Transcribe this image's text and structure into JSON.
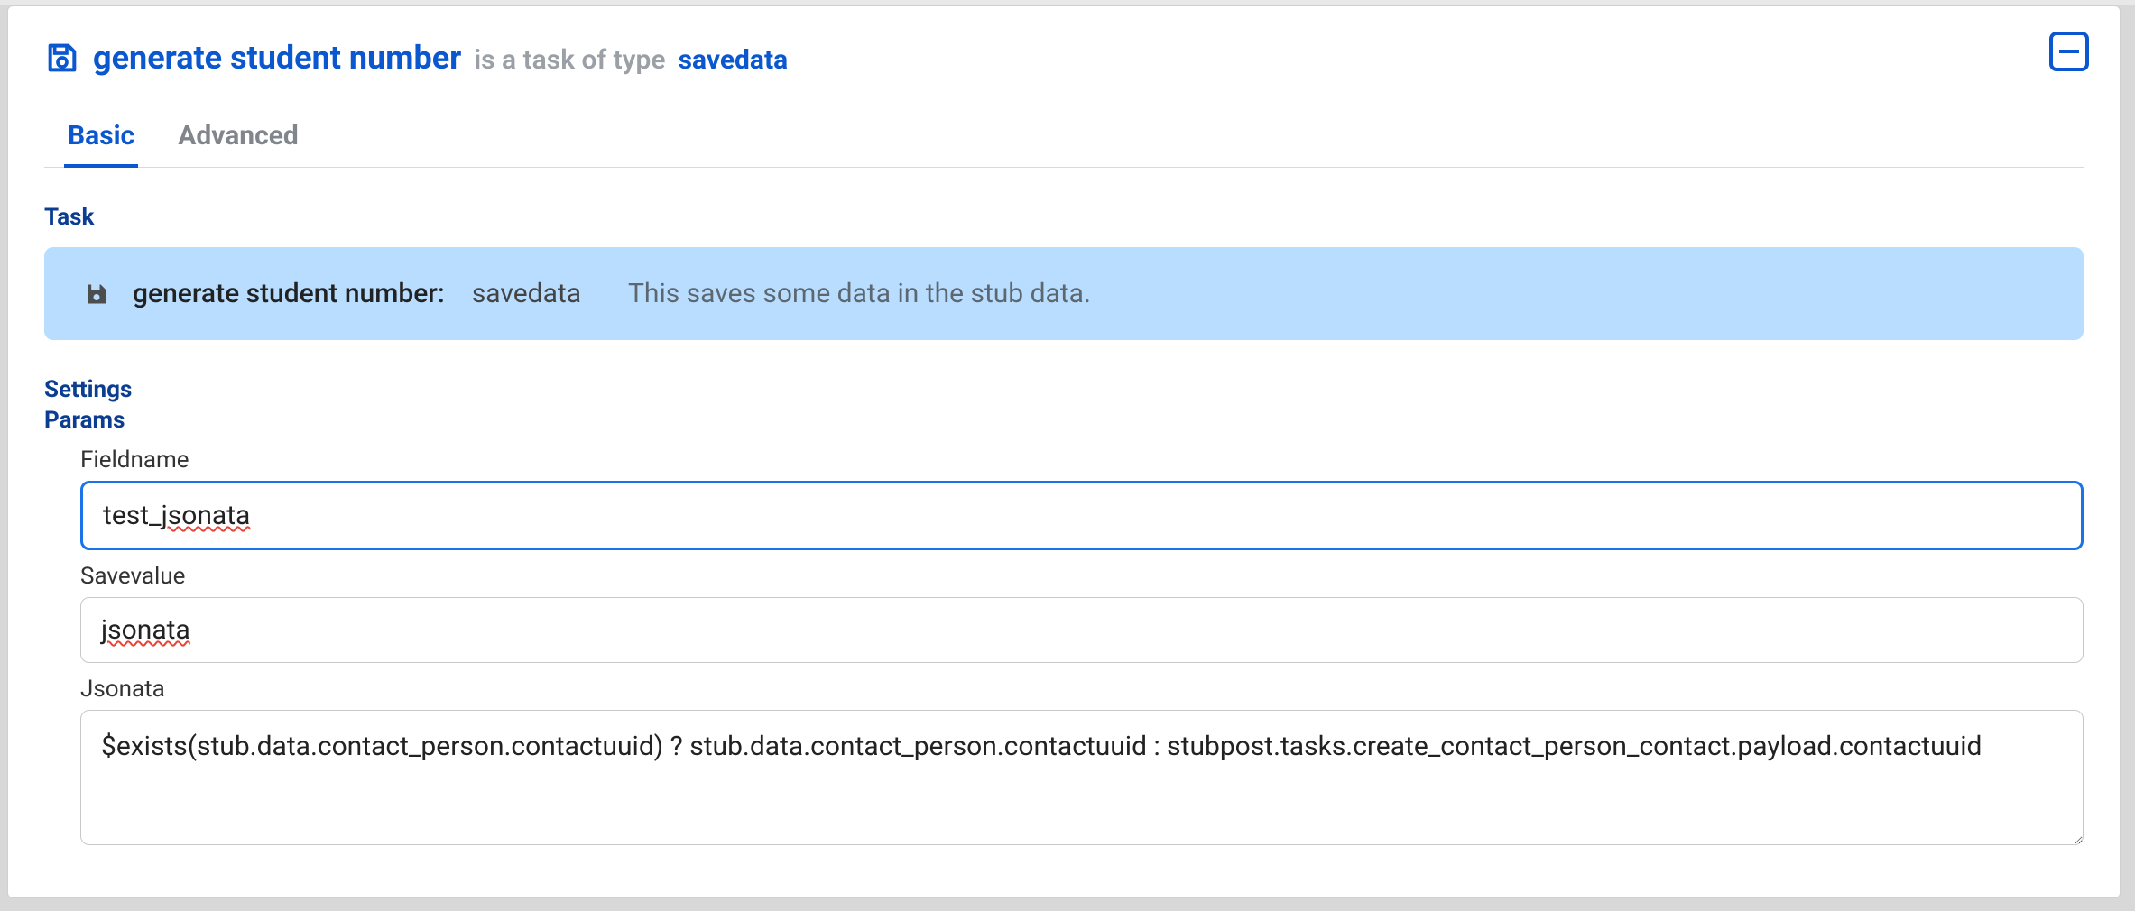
{
  "header": {
    "title": "generate student number",
    "subtitle": "is a task of type",
    "type": "savedata"
  },
  "tabs": [
    {
      "id": "basic",
      "label": "Basic",
      "active": true
    },
    {
      "id": "advanced",
      "label": "Advanced",
      "active": false
    }
  ],
  "sections": {
    "task_label": "Task",
    "settings_label": "Settings",
    "params_label": "Params"
  },
  "task_banner": {
    "name": "generate student number:",
    "type": "savedata",
    "description": "This saves some data in the stub data."
  },
  "params": {
    "fieldname": {
      "label": "Fieldname",
      "value": "test_jsonata"
    },
    "savevalue": {
      "label": "Savevalue",
      "value": "jsonata"
    },
    "jsonata": {
      "label": "Jsonata",
      "value": "$exists(stub.data.contact_person.contactuuid) ? stub.data.contact_person.contactuuid : stubpost.tasks.create_contact_person_contact.payload.contactuuid"
    }
  }
}
